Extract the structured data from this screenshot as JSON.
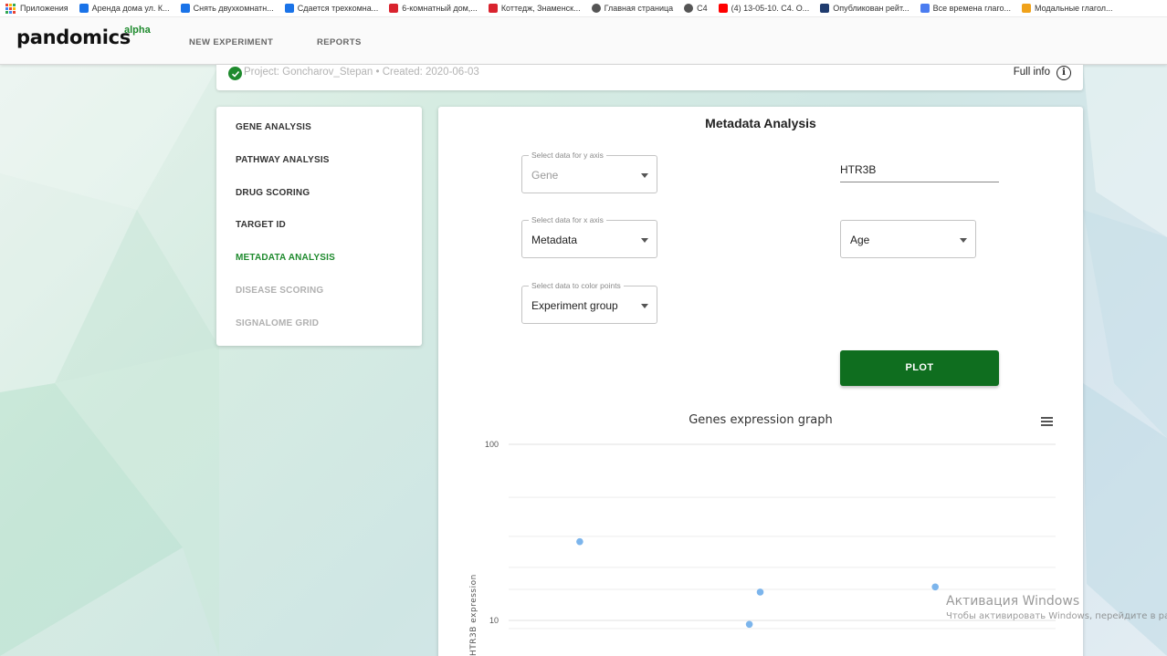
{
  "bookmarks": [
    {
      "label": "Приложения",
      "icon": "apps-grid-icon",
      "color": "#4285f4"
    },
    {
      "label": "Аренда дома ул. К...",
      "icon": "avito-icon",
      "color": "#1a73e8"
    },
    {
      "label": "Снять двухкомнатн...",
      "icon": "avito-icon",
      "color": "#1a73e8"
    },
    {
      "label": "Сдается трехкомна...",
      "icon": "avito-icon",
      "color": "#1a73e8"
    },
    {
      "label": "6-комнатный дом,...",
      "icon": "domclick-icon",
      "color": "#d9232e"
    },
    {
      "label": "Коттедж, Знаменск...",
      "icon": "domclick-icon",
      "color": "#d9232e"
    },
    {
      "label": "Главная страница",
      "icon": "globe-icon",
      "color": "#555555"
    },
    {
      "label": "C4",
      "icon": "globe-icon",
      "color": "#555555"
    },
    {
      "label": "(4) 13-05-10. C4. O...",
      "icon": "youtube-icon",
      "color": "#ff0000"
    },
    {
      "label": "Опубликован рейт...",
      "icon": "site-icon",
      "color": "#1f3b6e"
    },
    {
      "label": "Все времена глаго...",
      "icon": "s-icon",
      "color": "#4a7cf0"
    },
    {
      "label": "Модальные глагол...",
      "icon": "face-icon",
      "color": "#f0a21a"
    }
  ],
  "header": {
    "logo": "pandomics",
    "logo_suffix": "alpha",
    "nav": [
      "NEW EXPERIMENT",
      "REPORTS"
    ]
  },
  "project": {
    "text": "Project: Goncharov_Stepan • Created: 2020-06-03",
    "full_info_label": "Full info",
    "info_icon": "i"
  },
  "menu": [
    {
      "label": "GENE ANALYSIS",
      "state": "normal"
    },
    {
      "label": "PATHWAY ANALYSIS",
      "state": "normal"
    },
    {
      "label": "DRUG SCORING",
      "state": "normal"
    },
    {
      "label": "TARGET ID",
      "state": "normal"
    },
    {
      "label": "METADATA ANALYSIS",
      "state": "active"
    },
    {
      "label": "DISEASE SCORING",
      "state": "disabled"
    },
    {
      "label": "SIGNALOME GRID",
      "state": "disabled"
    }
  ],
  "panel": {
    "title": "Metadata Analysis",
    "y_axis_select": {
      "legend": "Select data for y axis",
      "value": "Gene"
    },
    "x_axis_select": {
      "legend": "Select data for x axis",
      "value": "Metadata"
    },
    "color_select": {
      "legend": "Select data to color points",
      "value": "Experiment group"
    },
    "gene_input_value": "HTR3B",
    "metadata_select_value": "Age",
    "plot_label": "PLOT"
  },
  "chart_data": {
    "type": "scatter",
    "title": "Genes expression graph",
    "ylabel": "HTR3B expression",
    "y_scale": "log",
    "y_ticks": [
      100,
      10
    ],
    "y_visible_range": [
      7.5,
      100
    ],
    "x_visible_range": [
      0,
      100
    ],
    "points": [
      {
        "x": 13,
        "y": 28
      },
      {
        "x": 44,
        "y": 9.5
      },
      {
        "x": 46,
        "y": 14.5
      },
      {
        "x": 78,
        "y": 15.5
      }
    ],
    "color": "#7cb5ec"
  },
  "watermark": {
    "line1": "Активация Windows",
    "line2": "Чтобы активировать Windows, перейдите в раздел"
  },
  "colors": {
    "brand_green": "#1e8a2d",
    "plot_button": "#0f6e1f",
    "point": "#7cb5ec"
  }
}
